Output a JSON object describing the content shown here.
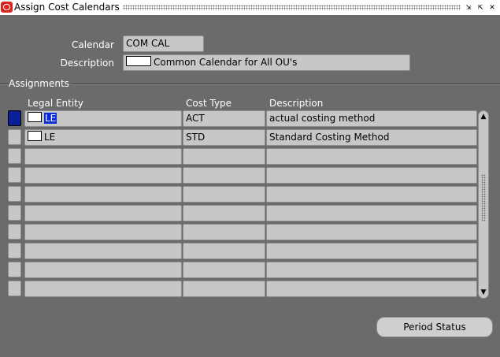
{
  "window": {
    "title": "Assign Cost Calendars",
    "controls": [
      "⇲",
      "⇱",
      "✕"
    ]
  },
  "header": {
    "calendar_label": "Calendar",
    "calendar_value": "COM CAL",
    "description_label": "Description",
    "description_value": "Common Calendar for All OU's"
  },
  "assignments": {
    "section_label": "Assignments",
    "columns": [
      "Legal Entity",
      "Cost Type",
      "Description"
    ],
    "rows": [
      {
        "legal_entity": "LE",
        "cost_type": "ACT",
        "description": "actual costing method"
      },
      {
        "legal_entity": "LE",
        "cost_type": "STD",
        "description": "Standard Costing Method"
      },
      {
        "legal_entity": "",
        "cost_type": "",
        "description": ""
      },
      {
        "legal_entity": "",
        "cost_type": "",
        "description": ""
      },
      {
        "legal_entity": "",
        "cost_type": "",
        "description": ""
      },
      {
        "legal_entity": "",
        "cost_type": "",
        "description": ""
      },
      {
        "legal_entity": "",
        "cost_type": "",
        "description": ""
      },
      {
        "legal_entity": "",
        "cost_type": "",
        "description": ""
      },
      {
        "legal_entity": "",
        "cost_type": "",
        "description": ""
      },
      {
        "legal_entity": "",
        "cost_type": "",
        "description": ""
      }
    ]
  },
  "buttons": {
    "period_status": "Period Status"
  },
  "icons": {
    "app": "oracle-forms-icon",
    "scroll_up": "▲",
    "scroll_down": "▼"
  },
  "colors": {
    "background": "#6b6b6b",
    "field": "#c7c7c7",
    "highlight": "#0a2cd8",
    "app_icon": "#d8261e"
  }
}
